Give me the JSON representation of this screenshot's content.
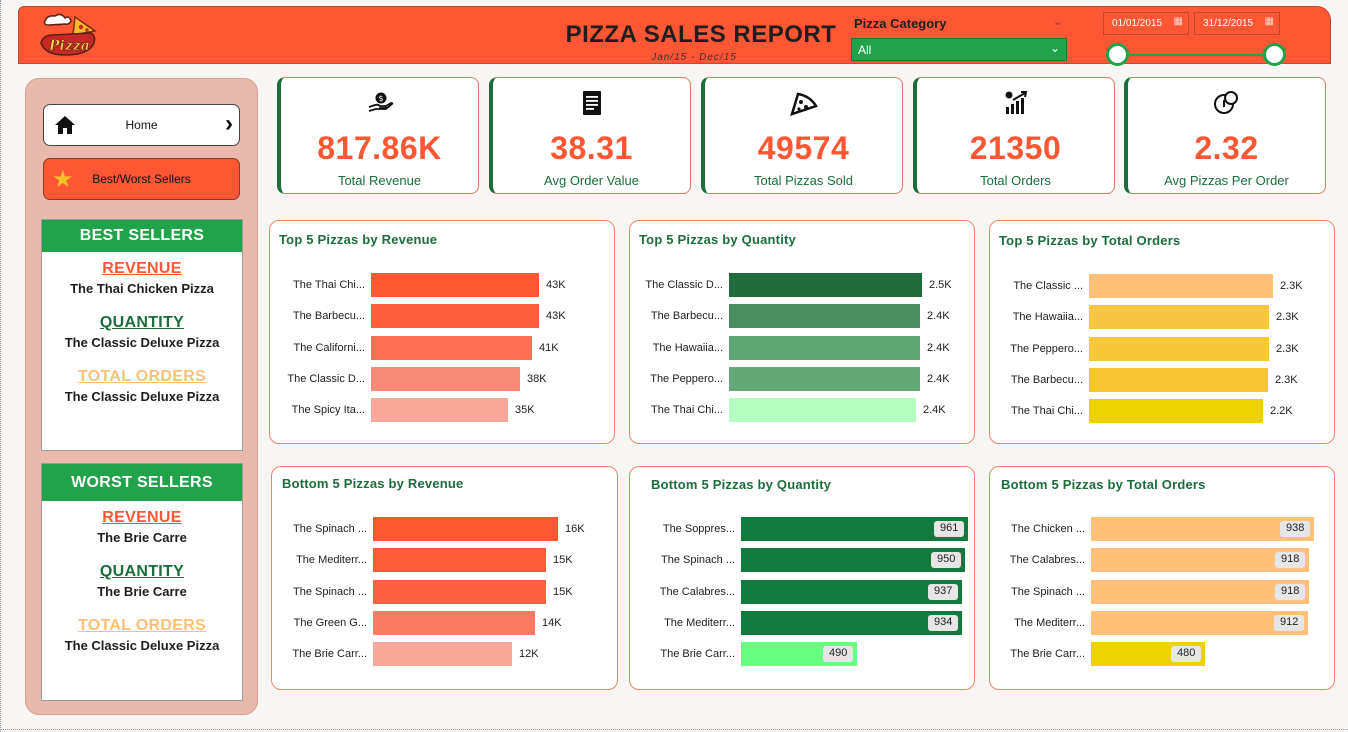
{
  "header": {
    "title": "PIZZA SALES REPORT",
    "subtitle": "Jan/15  -  Dec/15",
    "category_label": "Pizza Category",
    "category_value": "All",
    "date_start": "01/01/2015",
    "date_end": "31/12/2015"
  },
  "colors": {
    "primary": "#ff5733",
    "green": "#21a34a",
    "dark_green": "#1b6d3c",
    "peach": "#ffc07a"
  },
  "nav": {
    "home_label": "Home",
    "best_label": "Best/Worst Sellers"
  },
  "best_sellers": {
    "title": "BEST SELLERS",
    "items": [
      {
        "heading": "REVENUE",
        "value": "The Thai Chicken Pizza"
      },
      {
        "heading": "QUANTITY ",
        "value": "The Classic Deluxe Pizza"
      },
      {
        "heading": "TOTAL ORDERS",
        "value": "The Classic Deluxe Pizza"
      }
    ]
  },
  "worst_sellers": {
    "title": "WORST SELLERS",
    "items": [
      {
        "heading": "REVENUE",
        "value": "The Brie Carre"
      },
      {
        "heading": "QUANTITY ",
        "value": "The Brie Carre"
      },
      {
        "heading": "TOTAL ORDERS",
        "value": "The Classic Deluxe Pizza"
      }
    ]
  },
  "kpis": [
    {
      "icon": "money-hand-icon",
      "value": "817.86K",
      "label": "Total Revenue"
    },
    {
      "icon": "receipt-icon",
      "value": "38.31",
      "label": "Avg Order Value"
    },
    {
      "icon": "pizza-slice-icon",
      "value": "49574",
      "label": "Total Pizzas Sold"
    },
    {
      "icon": "bar-growth-icon",
      "value": "21350",
      "label": "Total Orders"
    },
    {
      "icon": "coins-icon",
      "value": "2.32",
      "label": "Avg Pizzas Per Order"
    }
  ],
  "chart_data": [
    {
      "type": "bar",
      "orientation": "horizontal",
      "title": "Top 5 Pizzas by Revenue",
      "categories": [
        "The Thai Chi...",
        "The Barbecu...",
        "The Californi...",
        "The Classic D...",
        "The Spicy Ita..."
      ],
      "values": [
        43,
        43,
        41,
        38,
        35
      ],
      "labels": [
        "43K",
        "43K",
        "41K",
        "38K",
        "35K"
      ],
      "colors": [
        "#ff5733",
        "#ff5e3f",
        "#ff6f55",
        "#fa8b78",
        "#f8a79b"
      ],
      "max": 43.4,
      "label_style": "outside"
    },
    {
      "type": "bar",
      "orientation": "horizontal",
      "title": "Top 5 Pizzas by Quantity",
      "categories": [
        "The Classic D...",
        "The Barbecu...",
        "The Hawaiia...",
        "The Peppero...",
        "The Thai Chi..."
      ],
      "values": [
        2.45,
        2.43,
        2.42,
        2.42,
        2.37
      ],
      "labels": [
        "2.5K",
        "2.4K",
        "2.4K",
        "2.4K",
        "2.4K"
      ],
      "colors": [
        "#1f6b3b",
        "#4a8d5e",
        "#5da572",
        "#65a877",
        "#b6ffc3"
      ],
      "max": 2.45,
      "label_style": "outside"
    },
    {
      "type": "bar",
      "orientation": "horizontal",
      "title": "Top 5 Pizzas by Total Orders",
      "categories": [
        "The Classic ...",
        "The Hawaiia...",
        "The Peppero...",
        "The Barbecu...",
        "The Thai Chi..."
      ],
      "values": [
        2.33,
        2.28,
        2.28,
        2.27,
        2.2
      ],
      "labels": [
        "2.3K",
        "2.3K",
        "2.3K",
        "2.3K",
        "2.2K"
      ],
      "colors": [
        "#ffc07a",
        "#f8c443",
        "#f8c63a",
        "#f6c42e",
        "#ecd200"
      ],
      "max": 2.33,
      "label_style": "outside"
    },
    {
      "type": "bar",
      "orientation": "horizontal",
      "title": "Bottom 5 Pizzas by Revenue",
      "categories": [
        "The Spinach ...",
        "The Mediterr...",
        "The Spinach ...",
        "The Green G...",
        "The Brie Carr..."
      ],
      "values": [
        16,
        15,
        15,
        14,
        12
      ],
      "labels": [
        "16K",
        "15K",
        "15K",
        "14K",
        "12K"
      ],
      "colors": [
        "#ff5733",
        "#ff5b39",
        "#ff6143",
        "#fb7a63",
        "#f8a79b"
      ],
      "max": 16,
      "label_style": "outside"
    },
    {
      "type": "bar",
      "orientation": "horizontal",
      "title": "Bottom 5 Pizzas by Quantity",
      "categories": [
        "The Soppres...",
        "The Spinach ...",
        "The Calabres...",
        "The Mediterr...",
        "The Brie Carr..."
      ],
      "values": [
        961,
        950,
        937,
        934,
        490
      ],
      "labels": [
        "961",
        "950",
        "937",
        "934",
        "490"
      ],
      "colors": [
        "#137a3f",
        "#137a3f",
        "#137a3f",
        "#137a3f",
        "#66ff7f"
      ],
      "max": 961,
      "label_style": "pill"
    },
    {
      "type": "bar",
      "orientation": "horizontal",
      "title": "Bottom 5 Pizzas by Total Orders",
      "categories": [
        "The Chicken ...",
        "The Calabres...",
        "The Spinach ...",
        "The Mediterr...",
        "The Brie Carr..."
      ],
      "values": [
        938,
        918,
        918,
        912,
        480
      ],
      "labels": [
        "938",
        "918",
        "918",
        "912",
        "480"
      ],
      "colors": [
        "#ffc07a",
        "#ffc07a",
        "#ffc07a",
        "#ffc07a",
        "#ecd200"
      ],
      "max": 938,
      "label_style": "pill"
    }
  ]
}
